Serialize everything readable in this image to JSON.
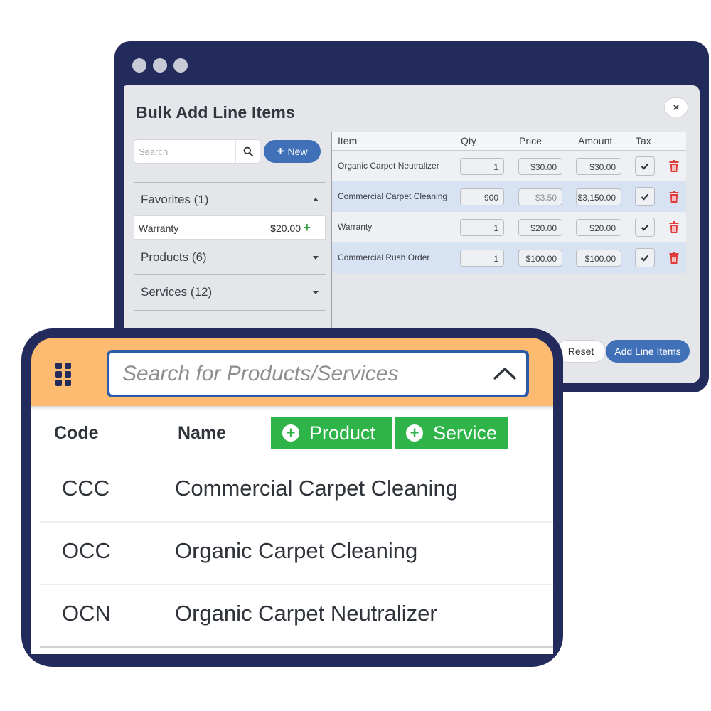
{
  "dialog": {
    "title": "Bulk Add Line Items",
    "close_glyph": "×",
    "search_placeholder": "Search",
    "new_button": "New",
    "new_glyph": "+",
    "favorites": {
      "label": "Favorites (1)",
      "items": [
        {
          "name": "Warranty",
          "price": "$20.00",
          "add_glyph": "+"
        }
      ]
    },
    "products_label": "Products (6)",
    "services_label": "Services (12)",
    "table": {
      "headers": [
        "Item",
        "Qty",
        "Price",
        "Amount",
        "Tax"
      ],
      "rows": [
        {
          "item": "Organic Carpet Neutralizer",
          "qty": "1",
          "price": "$30.00",
          "amount": "$30.00",
          "highlight": false
        },
        {
          "item": "Commercial Carpet Cleaning",
          "qty": "900",
          "price": "$3.50",
          "amount": "$3,150.00",
          "highlight": true
        },
        {
          "item": "Warranty",
          "qty": "1",
          "price": "$20.00",
          "amount": "$20.00",
          "highlight": false
        },
        {
          "item": "Commercial Rush Order",
          "qty": "1",
          "price": "$100.00",
          "amount": "$100.00",
          "highlight": true
        }
      ]
    },
    "reset_button": "Reset",
    "add_button": "Add Line Items"
  },
  "quick_search": {
    "placeholder": "Search for Products/Services",
    "headers": {
      "code": "Code",
      "name": "Name"
    },
    "product_button": "Product",
    "service_button": "Service",
    "plus_glyph": "+",
    "results": [
      {
        "code": "CCC",
        "name": "Commercial Carpet Cleaning"
      },
      {
        "code": "OCC",
        "name": "Organic Carpet Cleaning"
      },
      {
        "code": "OCN",
        "name": "Organic Carpet Neutralizer"
      }
    ]
  },
  "colors": {
    "window_frame": "#232a5c",
    "accent_blue": "#3f70b8",
    "header_orange": "#fcbb70",
    "green": "#2fb44a",
    "trash_red": "#e03a3a",
    "row_highlight": "#d7e2f3"
  },
  "icons": [
    "search-icon",
    "plus-icon",
    "caret-up-icon",
    "caret-down-icon",
    "check-icon",
    "trash-icon",
    "close-icon",
    "grip-icon",
    "chevron-up-icon"
  ]
}
